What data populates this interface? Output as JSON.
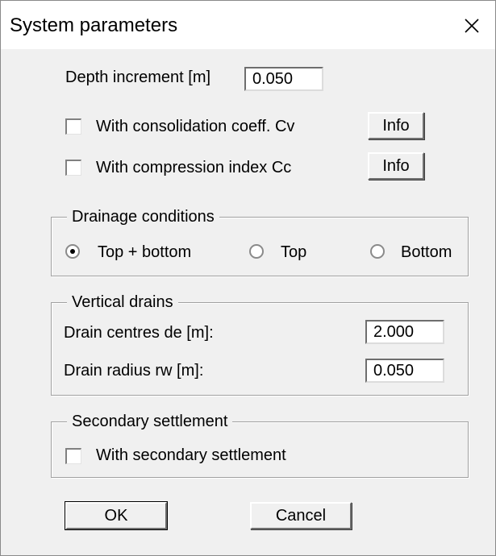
{
  "window": {
    "title": "System parameters"
  },
  "depth": {
    "label": "Depth increment [m]",
    "value": "0.050"
  },
  "options": {
    "consolidation": {
      "label": "With consolidation coeff. Cv",
      "info_label": "Info",
      "checked": false
    },
    "compression": {
      "label": "With compression index Cc",
      "info_label": "Info",
      "checked": false
    }
  },
  "drainage": {
    "legend": "Drainage conditions",
    "options": [
      {
        "label": "Top + bottom",
        "selected": true
      },
      {
        "label": "Top",
        "selected": false
      },
      {
        "label": "Bottom",
        "selected": false
      }
    ]
  },
  "vertical_drains": {
    "legend": "Vertical drains",
    "centres": {
      "label": "Drain centres de [m]:",
      "value": "2.000"
    },
    "radius": {
      "label": "Drain radius rw [m]:",
      "value": "0.050"
    }
  },
  "secondary": {
    "legend": "Secondary settlement",
    "checkbox": {
      "label": "With secondary settlement",
      "checked": false
    }
  },
  "buttons": {
    "ok": "OK",
    "cancel": "Cancel"
  },
  "icons": {
    "close": "close-icon",
    "radio_selected": "radio-dot-icon"
  }
}
